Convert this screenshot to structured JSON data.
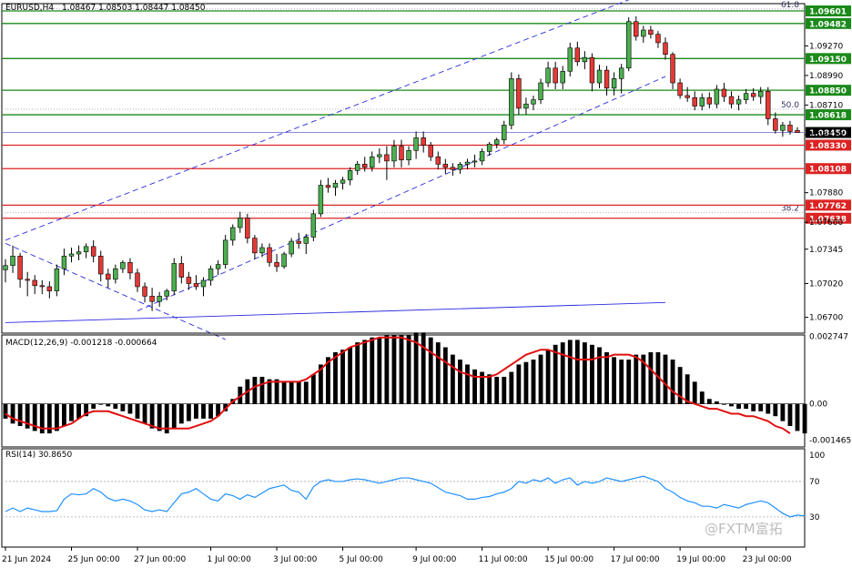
{
  "chart_data": [
    {
      "type": "candlestick",
      "symbol": "EURUSD,H4",
      "header_values": "1.08467 1.08503 1.08447 1.08450",
      "ylim": [
        1.0655,
        1.0967
      ],
      "price_ticks": [
        "1.09270",
        "1.08990",
        "1.08710",
        "1.08430",
        "1.07880",
        "1.07600",
        "1.07345",
        "1.07020",
        "1.06700"
      ],
      "current_price": "1.08450",
      "levels": [
        {
          "value": "1.09601",
          "kind": "support-resistance",
          "color": "#1a8a1a",
          "badge": "#1a8a1a"
        },
        {
          "value": "1.09482",
          "kind": "support-resistance",
          "color": "#1a8a1a",
          "badge": "#1a8a1a"
        },
        {
          "value": "1.09150",
          "kind": "support-resistance",
          "color": "#1a8a1a",
          "badge": "#1a8a1a"
        },
        {
          "value": "1.08850",
          "kind": "support-resistance",
          "color": "#1a8a1a",
          "badge": "#1a8a1a"
        },
        {
          "value": "1.08618",
          "kind": "support-resistance",
          "color": "#1a8a1a",
          "badge": "#1a8a1a"
        },
        {
          "value": "1.08330",
          "kind": "support-resistance",
          "color": "#dd2222",
          "badge": "#dd2222"
        },
        {
          "value": "1.08108",
          "kind": "support-resistance",
          "color": "#dd2222",
          "badge": "#dd2222"
        },
        {
          "value": "1.07762",
          "kind": "support-resistance",
          "color": "#dd2222",
          "badge": "#dd2222"
        },
        {
          "value": "1.07638",
          "kind": "support-resistance",
          "color": "#dd2222",
          "badge": "#dd2222"
        }
      ],
      "fibo_labels": [
        "61.8",
        "50.0",
        "38.2"
      ],
      "fibo_levels": [
        1.0962,
        1.0867,
        1.0769
      ],
      "channel": {
        "upper": [
          [
            0,
            1.0743
          ],
          [
            90,
            1.0984
          ]
        ],
        "lower": [
          [
            18,
            1.0676
          ],
          [
            90,
            1.0898
          ]
        ],
        "style": "dashed"
      },
      "descending_line": [
        [
          0,
          1.074
        ],
        [
          30,
          1.0649
        ]
      ],
      "long_trendline": [
        [
          0,
          1.0665
        ],
        [
          90,
          1.0684
        ]
      ],
      "candles": [
        [
          1.0715,
          1.0725,
          1.0703,
          1.0719
        ],
        [
          1.0719,
          1.0738,
          1.0712,
          1.0728
        ],
        [
          1.0728,
          1.0731,
          1.0698,
          1.0706
        ],
        [
          1.0706,
          1.0713,
          1.069,
          1.0705
        ],
        [
          1.0705,
          1.071,
          1.0692,
          1.07
        ],
        [
          1.07,
          1.0705,
          1.0692,
          1.0699
        ],
        [
          1.0699,
          1.0704,
          1.0688,
          1.0695
        ],
        [
          1.0695,
          1.072,
          1.069,
          1.0716
        ],
        [
          1.0716,
          1.0735,
          1.071,
          1.0728
        ],
        [
          1.0728,
          1.0736,
          1.0722,
          1.073
        ],
        [
          1.073,
          1.0738,
          1.0724,
          1.0732
        ],
        [
          1.0732,
          1.074,
          1.0726,
          1.0737
        ],
        [
          1.0737,
          1.0743,
          1.0722,
          1.0728
        ],
        [
          1.0728,
          1.0733,
          1.0704,
          1.0711
        ],
        [
          1.0711,
          1.0716,
          1.0698,
          1.0706
        ],
        [
          1.0706,
          1.072,
          1.0702,
          1.0716
        ],
        [
          1.0716,
          1.0724,
          1.0712,
          1.0722
        ],
        [
          1.0722,
          1.0726,
          1.0706,
          1.0712
        ],
        [
          1.0712,
          1.0716,
          1.0694,
          1.0699
        ],
        [
          1.0699,
          1.0703,
          1.0684,
          1.069
        ],
        [
          1.069,
          1.0698,
          1.0676,
          1.0685
        ],
        [
          1.0685,
          1.0694,
          1.068,
          1.069
        ],
        [
          1.069,
          1.0697,
          1.0686,
          1.0695
        ],
        [
          1.0695,
          1.0726,
          1.0691,
          1.0721
        ],
        [
          1.0721,
          1.0728,
          1.0702,
          1.0708
        ],
        [
          1.0708,
          1.0713,
          1.0696,
          1.0702
        ],
        [
          1.0702,
          1.071,
          1.0696,
          1.0699
        ],
        [
          1.0699,
          1.0708,
          1.069,
          1.0705
        ],
        [
          1.0705,
          1.0719,
          1.07,
          1.0716
        ],
        [
          1.0716,
          1.0724,
          1.071,
          1.072
        ],
        [
          1.072,
          1.0748,
          1.0716,
          1.0743
        ],
        [
          1.0743,
          1.0758,
          1.0738,
          1.0755
        ],
        [
          1.0755,
          1.077,
          1.075,
          1.0764
        ],
        [
          1.0764,
          1.0768,
          1.074,
          1.0745
        ],
        [
          1.0745,
          1.0748,
          1.0725,
          1.0731
        ],
        [
          1.0731,
          1.074,
          1.0727,
          1.0736
        ],
        [
          1.0736,
          1.074,
          1.0718,
          1.0722
        ],
        [
          1.0722,
          1.073,
          1.0713,
          1.0718
        ],
        [
          1.0718,
          1.0732,
          1.0716,
          1.073
        ],
        [
          1.073,
          1.0745,
          1.0727,
          1.0742
        ],
        [
          1.0742,
          1.075,
          1.0735,
          1.074
        ],
        [
          1.074,
          1.0749,
          1.073,
          1.0746
        ],
        [
          1.0746,
          1.0772,
          1.0742,
          1.0768
        ],
        [
          1.0768,
          1.08,
          1.0765,
          1.0795
        ],
        [
          1.0795,
          1.0802,
          1.0788,
          1.0793
        ],
        [
          1.0793,
          1.08,
          1.0785,
          1.0797
        ],
        [
          1.0797,
          1.0803,
          1.0791,
          1.08
        ],
        [
          1.08,
          1.0812,
          1.0795,
          1.0809
        ],
        [
          1.0809,
          1.0818,
          1.0805,
          1.0815
        ],
        [
          1.0815,
          1.0822,
          1.0808,
          1.0812
        ],
        [
          1.0812,
          1.0827,
          1.0808,
          1.0822
        ],
        [
          1.0822,
          1.083,
          1.0816,
          1.0824
        ],
        [
          1.0824,
          1.0832,
          1.08,
          1.0818
        ],
        [
          1.0818,
          1.0838,
          1.0812,
          1.0832
        ],
        [
          1.0832,
          1.0838,
          1.0812,
          1.0819
        ],
        [
          1.0819,
          1.0832,
          1.0814,
          1.0828
        ],
        [
          1.0828,
          1.0846,
          1.082,
          1.084
        ],
        [
          1.084,
          1.0846,
          1.0826,
          1.0833
        ],
        [
          1.0833,
          1.0836,
          1.0818,
          1.0822
        ],
        [
          1.0822,
          1.0827,
          1.081,
          1.0815
        ],
        [
          1.0815,
          1.082,
          1.0806,
          1.0812
        ],
        [
          1.0812,
          1.0816,
          1.0804,
          1.081
        ],
        [
          1.081,
          1.0817,
          1.0806,
          1.0815
        ],
        [
          1.0815,
          1.082,
          1.081,
          1.0817
        ],
        [
          1.0817,
          1.0824,
          1.0812,
          1.0818
        ],
        [
          1.0818,
          1.083,
          1.0814,
          1.0827
        ],
        [
          1.0827,
          1.0836,
          1.0823,
          1.0834
        ],
        [
          1.0834,
          1.084,
          1.083,
          1.0838
        ],
        [
          1.0838,
          1.0856,
          1.0834,
          1.0852
        ],
        [
          1.0852,
          1.0902,
          1.0848,
          1.0896
        ],
        [
          1.0896,
          1.09,
          1.0862,
          1.0868
        ],
        [
          1.0868,
          1.0878,
          1.0862,
          1.0872
        ],
        [
          1.0872,
          1.088,
          1.0866,
          1.0876
        ],
        [
          1.0876,
          1.0896,
          1.0872,
          1.0892
        ],
        [
          1.0892,
          1.0912,
          1.0888,
          1.0906
        ],
        [
          1.0906,
          1.0912,
          1.0886,
          1.0892
        ],
        [
          1.0892,
          1.0908,
          1.0886,
          1.0903
        ],
        [
          1.0903,
          1.093,
          1.0898,
          1.0925
        ],
        [
          1.0925,
          1.0931,
          1.0908,
          1.0912
        ],
        [
          1.0912,
          1.0922,
          1.0905,
          1.0916
        ],
        [
          1.0916,
          1.092,
          1.0884,
          1.0892
        ],
        [
          1.0892,
          1.0909,
          1.0887,
          1.0904
        ],
        [
          1.0904,
          1.0908,
          1.088,
          1.0887
        ],
        [
          1.0887,
          1.0902,
          1.088,
          1.0896
        ],
        [
          1.0896,
          1.091,
          1.0882,
          1.0906
        ],
        [
          1.0906,
          1.0954,
          1.0903,
          1.095
        ],
        [
          1.095,
          1.0955,
          1.0932,
          1.0936
        ],
        [
          1.0936,
          1.0946,
          1.093,
          1.0942
        ],
        [
          1.0942,
          1.0946,
          1.0934,
          1.0938
        ],
        [
          1.0938,
          1.0941,
          1.0925,
          1.093
        ],
        [
          1.093,
          1.0935,
          1.0914,
          1.0919
        ],
        [
          1.0919,
          1.0921,
          1.0886,
          1.0892
        ],
        [
          1.0892,
          1.0896,
          1.0877,
          1.088
        ],
        [
          1.088,
          1.0888,
          1.0874,
          1.0878
        ],
        [
          1.0878,
          1.0884,
          1.0866,
          1.087
        ],
        [
          1.087,
          1.0882,
          1.0866,
          1.0878
        ],
        [
          1.0878,
          1.0883,
          1.0868,
          1.0872
        ],
        [
          1.0872,
          1.089,
          1.0868,
          1.0886
        ],
        [
          1.0886,
          1.0892,
          1.0874,
          1.0879
        ],
        [
          1.0879,
          1.0884,
          1.0868,
          1.0872
        ],
        [
          1.0872,
          1.088,
          1.0866,
          1.0876
        ],
        [
          1.0876,
          1.0886,
          1.0872,
          1.0882
        ],
        [
          1.0882,
          1.0887,
          1.0875,
          1.0879
        ],
        [
          1.0879,
          1.0888,
          1.0872,
          1.0884
        ],
        [
          1.0884,
          1.0888,
          1.0852,
          1.0858
        ],
        [
          1.0858,
          1.0864,
          1.0844,
          1.0847
        ],
        [
          1.0847,
          1.0855,
          1.0841,
          1.0852
        ],
        [
          1.0852,
          1.0856,
          1.0843,
          1.0846
        ],
        [
          1.0847,
          1.085,
          1.0845,
          1.0845
        ]
      ],
      "x_labels": [
        "21 Jun 2024",
        "25 Jun 00:00",
        "27 Jun 00:00",
        "1 Jul 00:00",
        "3 Jul 00:00",
        "5 Jul 00:00",
        "9 Jul 00:00",
        "11 Jul 00:00",
        "15 Jul 00:00",
        "17 Jul 00:00",
        "19 Jul 00:00",
        "23 Jul 00:00"
      ]
    },
    {
      "type": "bar",
      "name": "MACD",
      "title": "MACD(12,26,9) -0.001218 -0.000664",
      "ylim": [
        -0.00175,
        0.0028
      ],
      "ticks": [
        "0.002747",
        "0.00",
        "-0.001465"
      ],
      "series": [
        {
          "kind": "histogram",
          "values": [
            -0.0006,
            -0.0008,
            -0.0009,
            -0.001,
            -0.0011,
            -0.0012,
            -0.0012,
            -0.0011,
            -0.0009,
            -0.0007,
            -0.0006,
            -0.0005,
            -0.0002,
            0.0,
            -0.0001,
            -0.0002,
            -0.0003,
            -0.0004,
            -0.0006,
            -0.0008,
            -0.001,
            -0.0011,
            -0.0012,
            -0.001,
            -0.0008,
            -0.0007,
            -0.0006,
            -0.0006,
            -0.0006,
            -0.0005,
            -0.0003,
            0.0002,
            0.0007,
            0.001,
            0.0011,
            0.0011,
            0.001,
            0.001,
            0.0009,
            0.0009,
            0.0009,
            0.0009,
            0.0012,
            0.0016,
            0.0019,
            0.0021,
            0.0022,
            0.0023,
            0.0025,
            0.0026,
            0.0027,
            0.0027,
            0.0028,
            0.0028,
            0.0028,
            0.0028,
            0.0029,
            0.0029,
            0.0027,
            0.0025,
            0.0023,
            0.002,
            0.0018,
            0.0016,
            0.0014,
            0.0013,
            0.0012,
            0.0011,
            0.0011,
            0.0013,
            0.0016,
            0.0017,
            0.0018,
            0.002,
            0.0022,
            0.0024,
            0.0025,
            0.0026,
            0.0026,
            0.0025,
            0.0024,
            0.0023,
            0.0021,
            0.0019,
            0.0018,
            0.0018,
            0.002,
            0.002,
            0.0021,
            0.0021,
            0.002,
            0.0018,
            0.0015,
            0.0012,
            0.0009,
            0.0005,
            0.0002,
            0.0001,
            0.0,
            -0.0001,
            -0.0002,
            -0.0002,
            -0.0003,
            -0.0003,
            -0.0004,
            -0.0005,
            -0.0007,
            -0.0009,
            -0.0011,
            -0.0012
          ]
        },
        {
          "kind": "signal",
          "values": [
            -0.0004,
            -0.0006,
            -0.0007,
            -0.0008,
            -0.0009,
            -0.001,
            -0.001,
            -0.001,
            -0.0009,
            -0.0008,
            -0.0006,
            -0.0004,
            -0.0003,
            -0.0003,
            -0.0003,
            -0.0004,
            -0.0005,
            -0.0006,
            -0.0007,
            -0.0008,
            -0.0009,
            -0.001,
            -0.001,
            -0.001,
            -0.001,
            -0.001,
            -0.0009,
            -0.0008,
            -0.0007,
            -0.0005,
            -0.0002,
            0.0001,
            0.0003,
            0.0005,
            0.0007,
            0.0008,
            0.0009,
            0.0009,
            0.0009,
            0.0009,
            0.0009,
            0.001,
            0.0012,
            0.0014,
            0.0017,
            0.0019,
            0.0021,
            0.0023,
            0.0024,
            0.0025,
            0.0026,
            0.0027,
            0.0027,
            0.0027,
            0.0027,
            0.0026,
            0.0025,
            0.0023,
            0.0021,
            0.0019,
            0.0017,
            0.0015,
            0.0013,
            0.0012,
            0.0011,
            0.0011,
            0.0011,
            0.0012,
            0.0014,
            0.0016,
            0.0018,
            0.002,
            0.0021,
            0.0022,
            0.0022,
            0.0021,
            0.002,
            0.0019,
            0.0018,
            0.0018,
            0.0018,
            0.0019,
            0.0019,
            0.002,
            0.002,
            0.002,
            0.0019,
            0.0017,
            0.0014,
            0.0011,
            0.0008,
            0.0005,
            0.0003,
            0.0001,
            0.0,
            -0.0001,
            -0.0002,
            -0.0002,
            -0.0003,
            -0.0004,
            -0.0004,
            -0.0005,
            -0.0005,
            -0.0006,
            -0.0007,
            -0.0009,
            -0.001,
            -0.0012
          ]
        }
      ]
    },
    {
      "type": "line",
      "name": "RSI",
      "title": "RSI(14) 30.8650",
      "ylim": [
        0,
        100
      ],
      "ticks": [
        "100",
        "70",
        "30"
      ],
      "levels": [
        70,
        30
      ],
      "values": [
        36,
        40,
        36,
        40,
        38,
        36,
        36,
        37,
        50,
        56,
        55,
        56,
        62,
        58,
        51,
        48,
        50,
        48,
        44,
        38,
        36,
        38,
        36,
        46,
        56,
        58,
        62,
        56,
        50,
        48,
        56,
        54,
        50,
        55,
        52,
        57,
        62,
        64,
        66,
        60,
        58,
        50,
        64,
        70,
        72,
        70,
        70,
        72,
        73,
        72,
        70,
        68,
        70,
        72,
        74,
        74,
        72,
        70,
        68,
        63,
        58,
        56,
        54,
        50,
        50,
        52,
        53,
        56,
        58,
        62,
        70,
        68,
        72,
        70,
        74,
        68,
        72,
        74,
        66,
        70,
        68,
        70,
        74,
        72,
        70,
        72,
        74,
        76,
        73,
        70,
        62,
        58,
        52,
        48,
        46,
        42,
        42,
        40,
        44,
        42,
        40,
        44,
        46,
        48,
        46,
        40,
        34,
        30,
        32,
        31
      ]
    }
  ],
  "watermark": "@FXTM富拓"
}
